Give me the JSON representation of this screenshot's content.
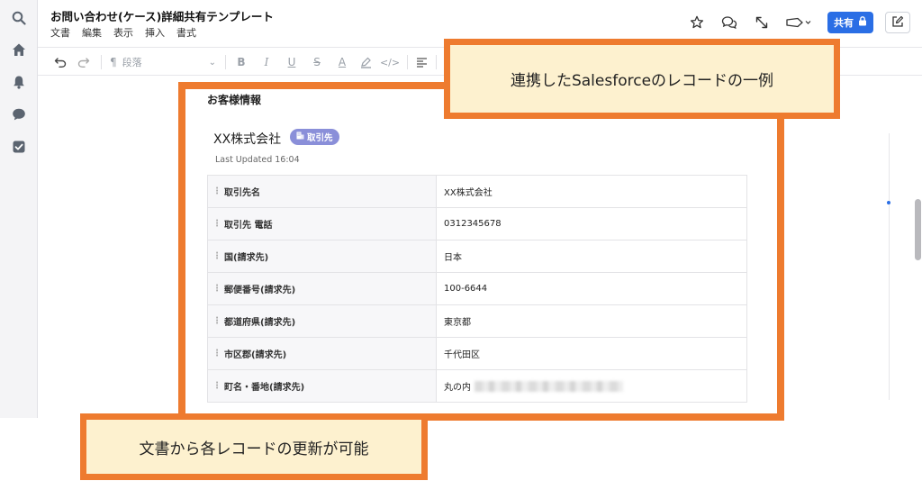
{
  "document": {
    "title": "お問い合わせ(ケース)詳細共有テンプレート",
    "menu": [
      "文書",
      "編集",
      "表示",
      "挿入",
      "書式"
    ]
  },
  "header": {
    "share_label": "共有"
  },
  "toolbar": {
    "paragraph_style": "段落"
  },
  "section": {
    "heading": "お客様情報"
  },
  "record": {
    "account_name": "XX株式会社",
    "badge": "取引先",
    "last_updated": "Last Updated 16:04",
    "fields": [
      {
        "label": "取引先名",
        "value": "XX株式会社"
      },
      {
        "label": "取引先 電話",
        "value": "0312345678"
      },
      {
        "label": "国(請求先)",
        "value": "日本"
      },
      {
        "label": "郵便番号(請求先)",
        "value": "100-6644"
      },
      {
        "label": "都道府県(請求先)",
        "value": "東京都"
      },
      {
        "label": "市区郡(請求先)",
        "value": "千代田区"
      },
      {
        "label": "町名・番地(請求先)",
        "value": "丸の内"
      }
    ]
  },
  "annotations": {
    "top": "連携したSalesforceのレコードの一例",
    "bottom": "文書から各レコードの更新が可能"
  },
  "colors": {
    "accent": "#2a6ee5",
    "callout_border": "#ee7b2f",
    "callout_fill": "#fdf1cf",
    "badge": "#8a8fd9"
  }
}
